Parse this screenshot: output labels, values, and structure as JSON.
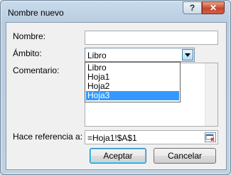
{
  "window": {
    "title": "Nombre nuevo",
    "help_label": "?",
    "close_label": "✕"
  },
  "form": {
    "nombre_label": "Nombre:",
    "nombre_value": "",
    "ambito_label": "Ámbito:",
    "ambito_value": "Libro",
    "ambito_options": [
      "Libro",
      "Hoja1",
      "Hoja2",
      "Hoja3"
    ],
    "ambito_highlighted": "Hoja3",
    "comentario_label": "Comentario:",
    "referencia_label": "Hace referencia a:",
    "referencia_value": "=Hoja1!$A$1"
  },
  "buttons": {
    "aceptar": "Aceptar",
    "cancelar": "Cancelar"
  },
  "icons": {
    "collapse_dialog": "range-select-icon"
  }
}
